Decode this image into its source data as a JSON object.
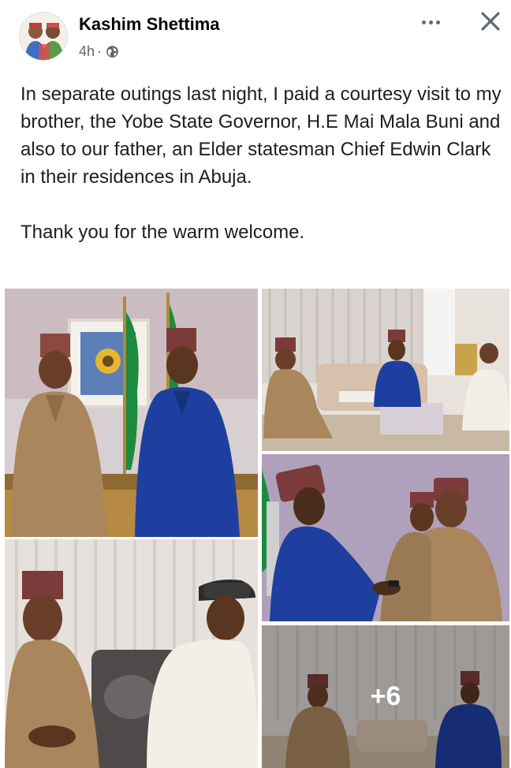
{
  "post": {
    "author": "Kashim Shettima",
    "time": "4h",
    "separator": "·",
    "icons": {
      "privacy": "globe-icon",
      "more": "more-options-icon",
      "close": "close-icon"
    },
    "text_paragraph_1": "In separate outings last night, I paid a courtesy visit to my brother, the Yobe State Governor, H.E Mai Mala Buni and also to our father, an Elder statesman Chief Edwin Clark in their residences in Abuja.",
    "text_paragraph_2": "Thank you for the warm welcome."
  },
  "photos": {
    "count_shown": 5,
    "more_label": "+6"
  },
  "colors": {
    "name": "#050505",
    "meta": "#65676b",
    "body_text": "#1c1e21",
    "kaftan_tan": "#a9865c",
    "kaftan_blue": "#1f3fa0",
    "cap_maroon": "#7a3b3a"
  }
}
